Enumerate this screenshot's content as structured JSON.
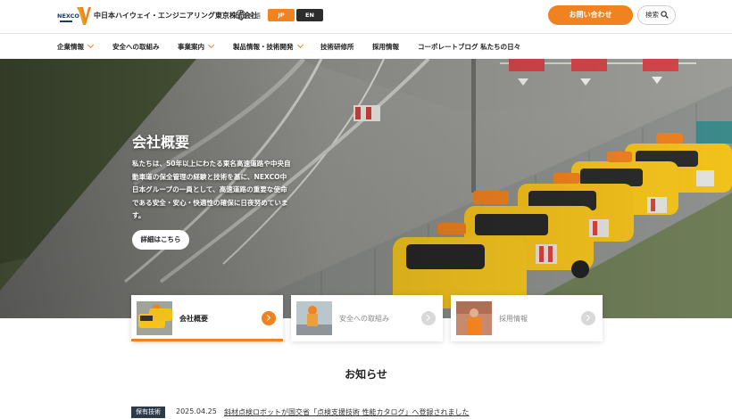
{
  "header": {
    "logo_text": "NEXCO",
    "company_name": "中日本ハイウェイ・エンジニアリング東京株式会社",
    "lang_label": "言語",
    "lang_options": [
      "JP",
      "EN"
    ],
    "contact_label": "お問い合わせ",
    "search_label": "検索"
  },
  "nav": {
    "items": [
      {
        "label": "企業情報"
      },
      {
        "label": "安全への取組み"
      },
      {
        "label": "事業案内"
      },
      {
        "label": "製品情報・技術開発"
      },
      {
        "label": "技術研修所"
      },
      {
        "label": "採用情報"
      },
      {
        "label": "コーポレートブログ 私たちの日々"
      }
    ]
  },
  "hero": {
    "title": "会社概要",
    "text": "私たちは、50年以上にわたる東名高速道路や中央自動車道の保全管理の経験と技術を基に、NEXCO中日本グループの一員として、高速道路の重要な使命である安全・安心・快適性の確保に日夜努めています。",
    "button_label": "詳細はこちら"
  },
  "cards": [
    {
      "label": "会社概要"
    },
    {
      "label": "安全への取組み"
    },
    {
      "label": "採用情報"
    }
  ],
  "news": {
    "heading": "お知らせ",
    "items": [
      {
        "tag": "保有技術",
        "date": "2025.04.25",
        "title": "斜材点検ロボットが国交省「点検支援技術 性能カタログ」へ登録されました"
      }
    ]
  },
  "colors": {
    "accent": "#f08220",
    "dark": "#2d2d2d",
    "tag_bg": "#2d3a4a"
  }
}
